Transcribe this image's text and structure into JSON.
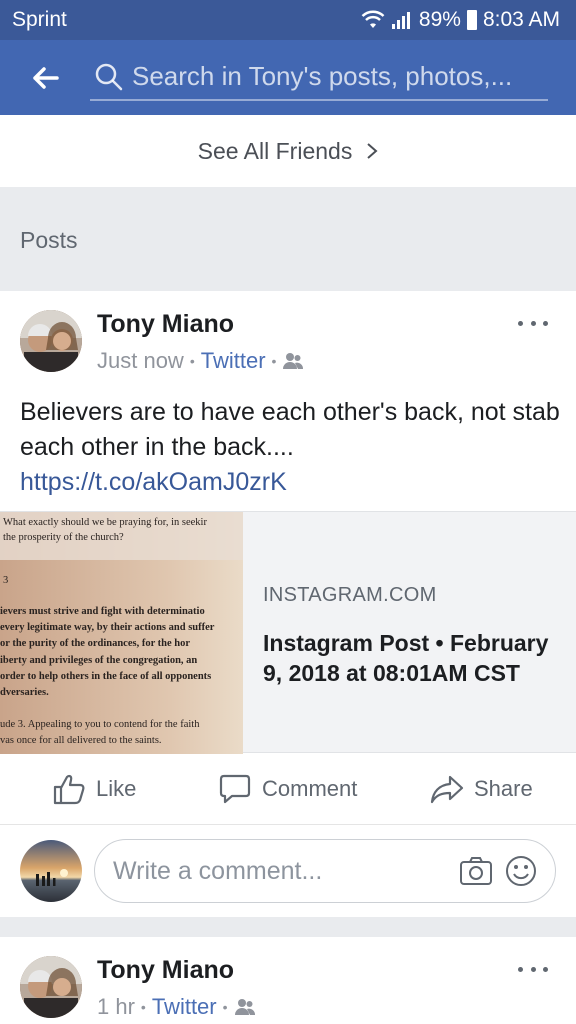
{
  "status_bar": {
    "carrier": "Sprint",
    "battery": "89%",
    "time": "8:03 AM"
  },
  "search": {
    "placeholder": "Search in Tony's posts, photos,..."
  },
  "friends": {
    "see_all_label": "See All Friends"
  },
  "posts_section": {
    "label": "Posts"
  },
  "posts": [
    {
      "author": "Tony Miano",
      "time": "Just now",
      "source": "Twitter",
      "text": "Believers are to have each other's back, not stab each other in the back....",
      "link": "https://t.co/akOamJ0zrK",
      "preview": {
        "domain": "INSTAGRAM.COM",
        "title": "Instagram Post • February 9, 2018 at 08:01AM CST",
        "image_text": [
          "What exactly should we be praying for, in seekir",
          "the prosperity of the church?",
          "3",
          "ievers must strive and fight with determinatio",
          "every legitimate way, by their actions and suffer",
          "or the purity of the ordinances, for the hor",
          "iberty and privileges of the congregation, an",
          "order to help others in the face of all opponents",
          "dversaries.",
          "ude 3. Appealing to you to contend for the faith",
          "vas once for all delivered to the saints."
        ]
      }
    },
    {
      "author": "Tony Miano",
      "time": "1 hr",
      "source": "Twitter"
    }
  ],
  "actions": {
    "like": "Like",
    "comment": "Comment",
    "share": "Share"
  },
  "comment": {
    "placeholder": "Write a comment..."
  },
  "colors": {
    "header_bg": "#4267b2",
    "status_bg": "#3b5998",
    "link": "#385898",
    "feed_bg": "#e9ebee"
  }
}
